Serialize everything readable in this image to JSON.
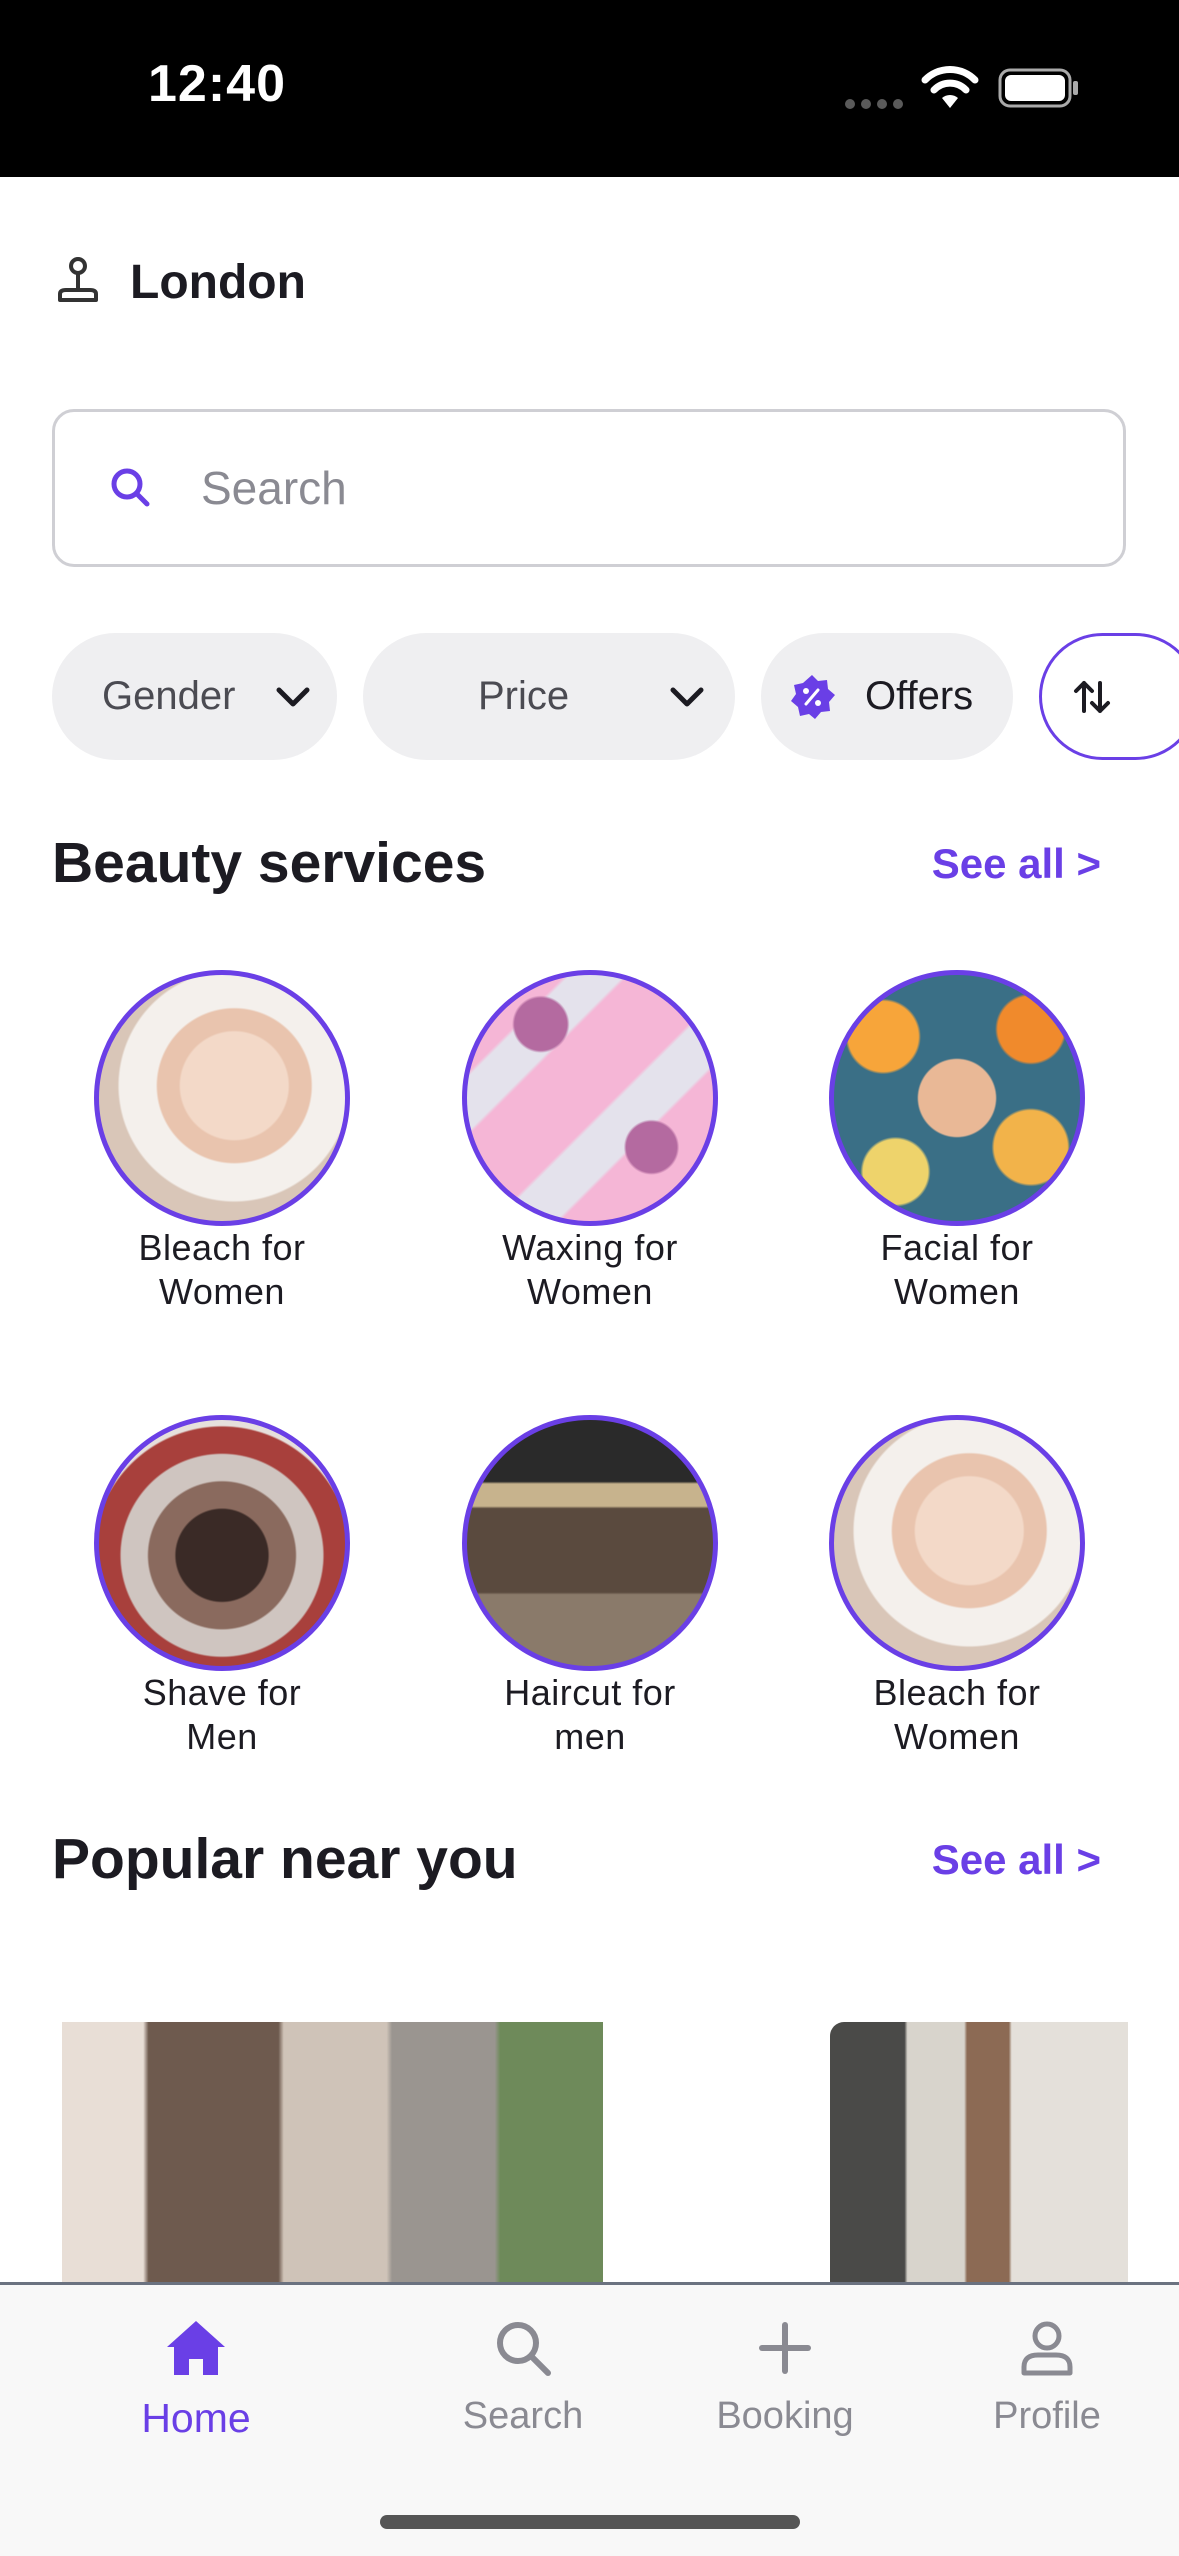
{
  "status_bar": {
    "time": "12:40"
  },
  "location": {
    "label": "London",
    "icon": "pin-icon"
  },
  "search": {
    "placeholder": "Search"
  },
  "filters": {
    "gender": "Gender",
    "price": "Price",
    "offers": "Offers"
  },
  "beauty_section": {
    "title": "Beauty services",
    "see_all": "See all >",
    "items": [
      {
        "label": "Bleach for\nWomen"
      },
      {
        "label": "Waxing for\nWomen"
      },
      {
        "label": "Facial for\nWomen"
      },
      {
        "label": "Shave for\nMen"
      },
      {
        "label": "Haircut for\nmen"
      },
      {
        "label": "Bleach for\nWomen"
      }
    ]
  },
  "popular_section": {
    "title": "Popular near you",
    "see_all": "See all >"
  },
  "tabbar": {
    "items": [
      {
        "label": "Home",
        "icon": "home-icon",
        "active": true
      },
      {
        "label": "Search",
        "icon": "search-icon",
        "active": false
      },
      {
        "label": "Booking",
        "icon": "plus-icon",
        "active": false
      },
      {
        "label": "Profile",
        "icon": "profile-icon",
        "active": false
      }
    ]
  },
  "colors": {
    "accent": "#6a3fe6",
    "chip_bg": "#efeff1",
    "tabbar_bg": "#f8f8f8"
  }
}
